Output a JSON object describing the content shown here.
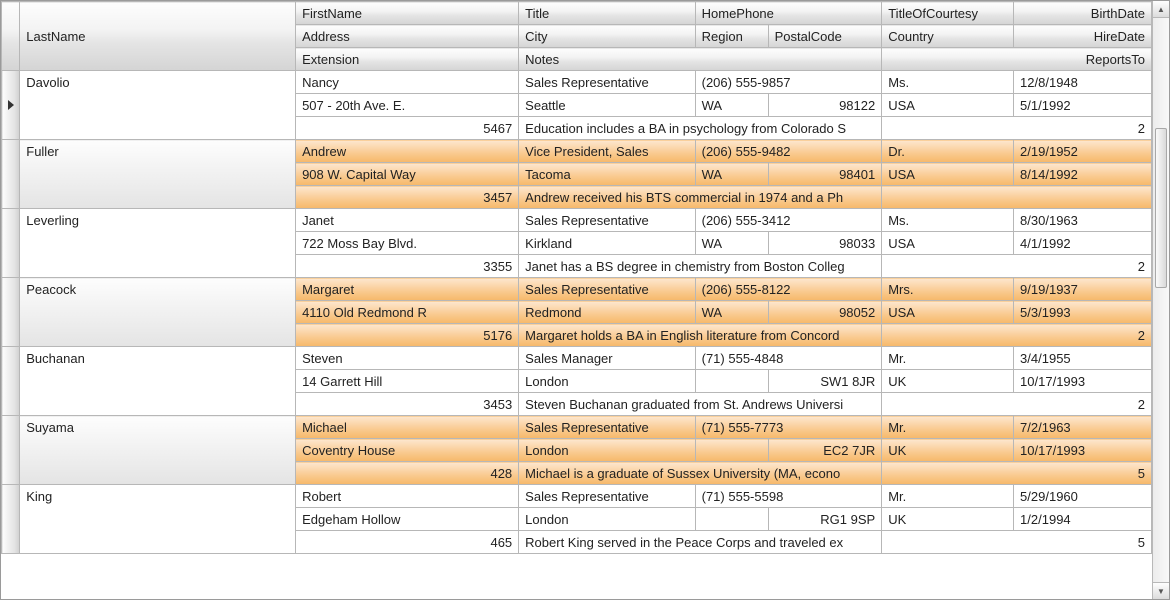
{
  "headers": {
    "LastName": "LastName",
    "FirstName": "FirstName",
    "Title": "Title",
    "HomePhone": "HomePhone",
    "TitleOfCourtesy": "TitleOfCourtesy",
    "BirthDate": "BirthDate",
    "Address": "Address",
    "City": "City",
    "Region": "Region",
    "PostalCode": "PostalCode",
    "Country": "Country",
    "HireDate": "HireDate",
    "Extension": "Extension",
    "Notes": "Notes",
    "ReportsTo": "ReportsTo"
  },
  "rows": [
    {
      "highlight": false,
      "current": true,
      "LastName": "Davolio",
      "FirstName": "Nancy",
      "Title": "Sales Representative",
      "HomePhone": "(206) 555-9857",
      "TitleOfCourtesy": "Ms.",
      "BirthDate": "12/8/1948",
      "Address": "507 - 20th Ave. E.",
      "City": "Seattle",
      "Region": "WA",
      "PostalCode": "98122",
      "Country": "USA",
      "HireDate": "5/1/1992",
      "Extension": "5467",
      "Notes": "Education includes a BA in psychology from Colorado S",
      "ReportsTo": "2"
    },
    {
      "highlight": true,
      "current": false,
      "LastName": "Fuller",
      "FirstName": "Andrew",
      "Title": "Vice President, Sales",
      "HomePhone": "(206) 555-9482",
      "TitleOfCourtesy": "Dr.",
      "BirthDate": "2/19/1952",
      "Address": "908 W. Capital Way",
      "City": "Tacoma",
      "Region": "WA",
      "PostalCode": "98401",
      "Country": "USA",
      "HireDate": "8/14/1992",
      "Extension": "3457",
      "Notes": "Andrew received his BTS commercial in 1974 and a Ph",
      "ReportsTo": ""
    },
    {
      "highlight": false,
      "current": false,
      "LastName": "Leverling",
      "FirstName": "Janet",
      "Title": "Sales Representative",
      "HomePhone": "(206) 555-3412",
      "TitleOfCourtesy": "Ms.",
      "BirthDate": "8/30/1963",
      "Address": "722 Moss Bay Blvd.",
      "City": "Kirkland",
      "Region": "WA",
      "PostalCode": "98033",
      "Country": "USA",
      "HireDate": "4/1/1992",
      "Extension": "3355",
      "Notes": "Janet has a BS degree in chemistry from Boston Colleg",
      "ReportsTo": "2"
    },
    {
      "highlight": true,
      "current": false,
      "LastName": "Peacock",
      "FirstName": "Margaret",
      "Title": "Sales Representative",
      "HomePhone": "(206) 555-8122",
      "TitleOfCourtesy": "Mrs.",
      "BirthDate": "9/19/1937",
      "Address": "4110 Old Redmond R",
      "City": "Redmond",
      "Region": "WA",
      "PostalCode": "98052",
      "Country": "USA",
      "HireDate": "5/3/1993",
      "Extension": "5176",
      "Notes": "Margaret holds a BA in English literature from Concord",
      "ReportsTo": "2"
    },
    {
      "highlight": false,
      "current": false,
      "LastName": "Buchanan",
      "FirstName": "Steven",
      "Title": "Sales Manager",
      "HomePhone": "(71) 555-4848",
      "TitleOfCourtesy": "Mr.",
      "BirthDate": "3/4/1955",
      "Address": "14 Garrett Hill",
      "City": "London",
      "Region": "",
      "PostalCode": "SW1 8JR",
      "Country": "UK",
      "HireDate": "10/17/1993",
      "Extension": "3453",
      "Notes": "Steven Buchanan graduated from St. Andrews Universi",
      "ReportsTo": "2"
    },
    {
      "highlight": true,
      "current": false,
      "LastName": "Suyama",
      "FirstName": "Michael",
      "Title": "Sales Representative",
      "HomePhone": "(71) 555-7773",
      "TitleOfCourtesy": "Mr.",
      "BirthDate": "7/2/1963",
      "Address": "Coventry House",
      "City": "London",
      "Region": "",
      "PostalCode": "EC2 7JR",
      "Country": "UK",
      "HireDate": "10/17/1993",
      "Extension": "428",
      "Notes": "Michael is a graduate of Sussex University (MA, econo",
      "ReportsTo": "5"
    },
    {
      "highlight": false,
      "current": false,
      "LastName": "King",
      "FirstName": "Robert",
      "Title": "Sales Representative",
      "HomePhone": "(71) 555-5598",
      "TitleOfCourtesy": "Mr.",
      "BirthDate": "5/29/1960",
      "Address": "Edgeham Hollow",
      "City": "London",
      "Region": "",
      "PostalCode": "RG1 9SP",
      "Country": "UK",
      "HireDate": "1/2/1994",
      "Extension": "465",
      "Notes": "Robert King served in the Peace Corps and traveled ex",
      "ReportsTo": "5"
    }
  ]
}
